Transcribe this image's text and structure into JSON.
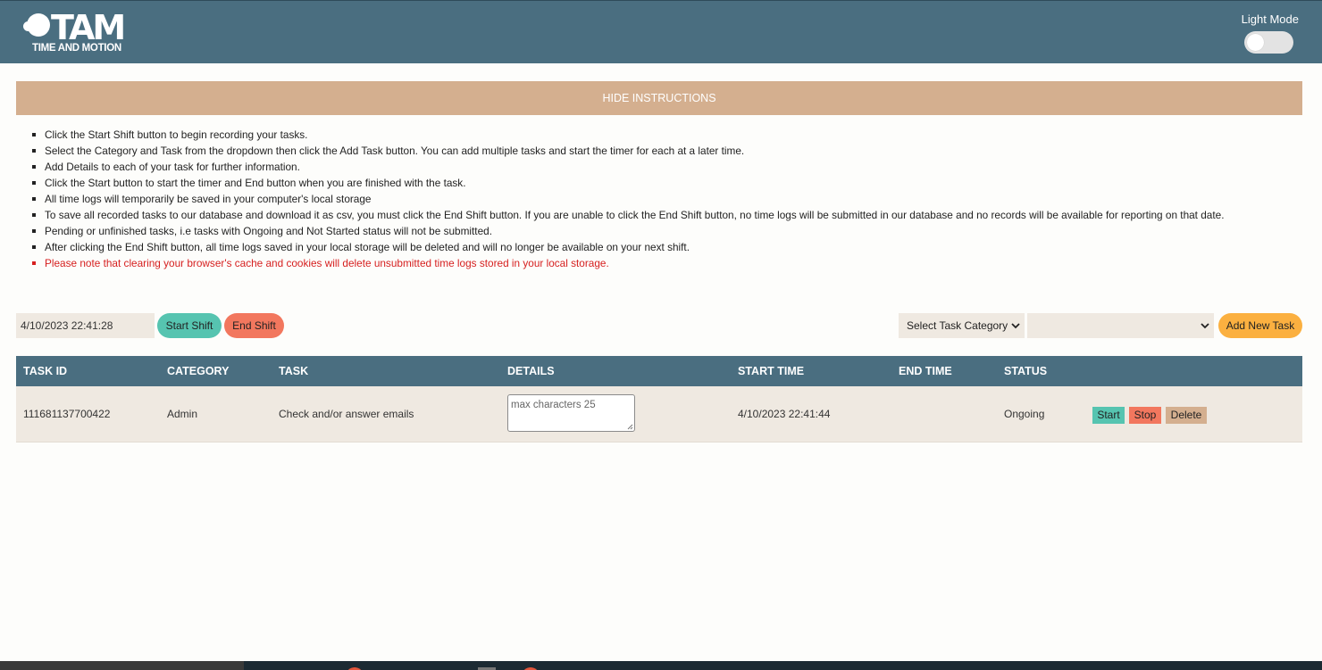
{
  "header": {
    "logo_big": "TAM",
    "logo_small": "TIME AND MOTION",
    "mode_label": "Light Mode",
    "accent": "#4a6e80"
  },
  "instructions": {
    "toggle_label": "HIDE INSTRUCTIONS",
    "items": [
      "Click the Start Shift button to begin recording your tasks.",
      "Select the Category and Task from the dropdown then click the Add Task button. You can add multiple tasks and start the timer for each at a later time.",
      "Add Details to each of your task for further information.",
      "Click the Start button to start the timer and End button when you are finished with the task.",
      "All time logs will temporarily be saved in your computer's local storage",
      "To save all recorded tasks to our database and download it as csv, you must click the End Shift button. If you are unable to click the End Shift button, no time logs will be submitted in our database and no records will be available for reporting on that date.",
      "Pending or unfinished tasks, i.e tasks with Ongoing and Not Started status will not be submitted.",
      "After clicking the End Shift button, all time logs saved in your local storage will be deleted and will no longer be available on your next shift.",
      "Please note that clearing your browser's cache and cookies will delete unsubmitted time logs stored in your local storage."
    ]
  },
  "controls": {
    "datetime": "4/10/2023 22:41:28",
    "start_shift": "Start Shift",
    "end_shift": "End Shift",
    "category_select": "Select Task Category",
    "task_select": "",
    "add_task": "Add New Task"
  },
  "table": {
    "headers": [
      "TASK ID",
      "CATEGORY",
      "TASK",
      "DETAILS",
      "START TIME",
      "END TIME",
      "STATUS"
    ],
    "rows": [
      {
        "task_id": "111681137700422",
        "category": "Admin",
        "task": "Check and/or answer emails",
        "details_placeholder": "max characters 25",
        "start_time": "4/10/2023 22:41:44",
        "end_time": "",
        "status": "Ongoing",
        "actions": [
          "Start",
          "Stop",
          "Delete"
        ]
      }
    ]
  },
  "colors": {
    "teal": "#56c4b0",
    "coral": "#f2775e",
    "tan": "#d4af8f",
    "orange": "#fbb040",
    "beige": "#efe9e1"
  }
}
